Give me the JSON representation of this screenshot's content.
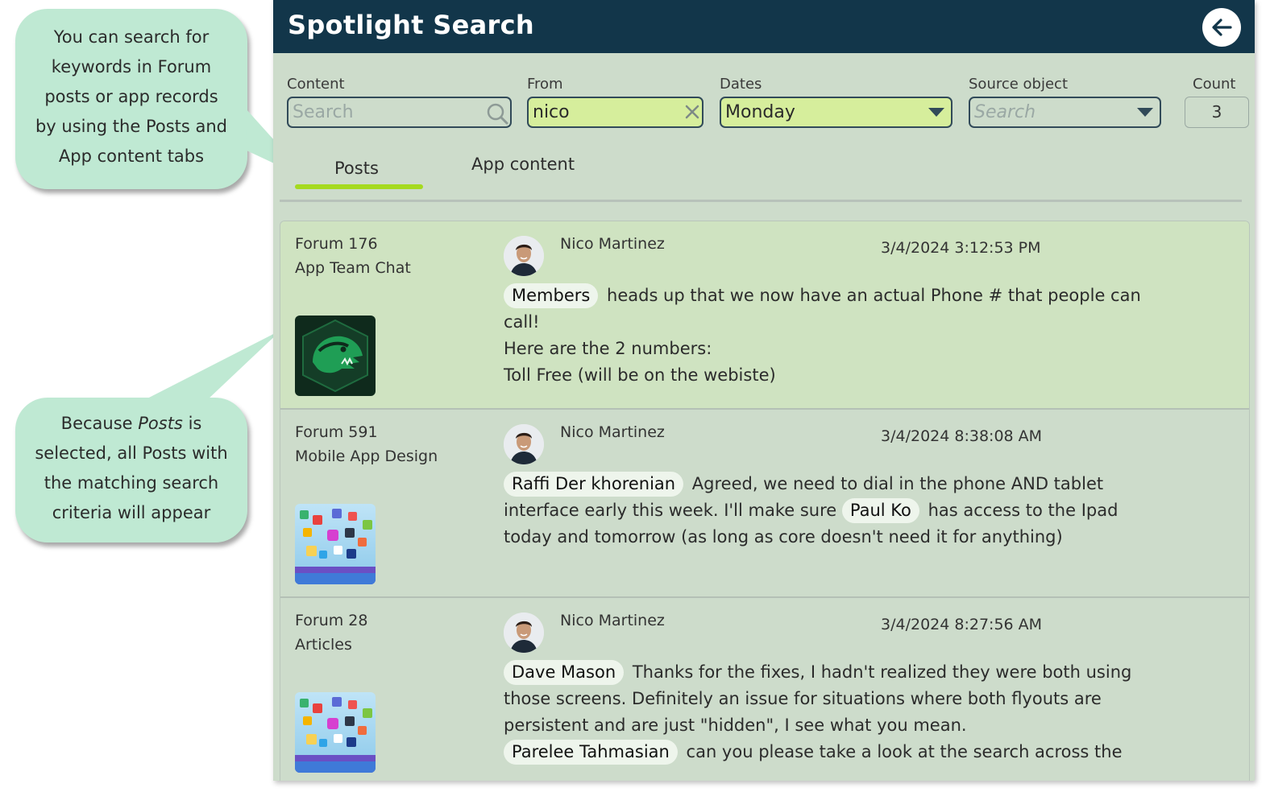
{
  "callouts": [
    {
      "lines": [
        "You can search for",
        "keywords in Forum",
        "posts or app records",
        "by using the Posts and",
        "App content tabs"
      ]
    },
    {
      "line1_pre": "Because ",
      "line1_em": "Posts",
      "line1_post": " is",
      "lines": [
        "selected, all Posts with",
        "the matching search",
        "criteria will appear"
      ]
    }
  ],
  "header": {
    "title": "Spotlight Search"
  },
  "filters": {
    "content": {
      "label": "Content",
      "placeholder": "Search"
    },
    "from": {
      "label": "From",
      "value": "nico"
    },
    "dates": {
      "label": "Dates",
      "value": "Monday"
    },
    "source": {
      "label": "Source object",
      "placeholder": "Search"
    },
    "count": {
      "label": "Count",
      "value": "3"
    }
  },
  "tabs": [
    {
      "label": "Posts",
      "selected": true
    },
    {
      "label": "App content",
      "selected": false
    }
  ],
  "colors": {
    "header": "#12364a",
    "accent": "#a5da1f",
    "field_active": "#d6ee9c",
    "callout": "#bfe9d3",
    "panel": "#cddccb"
  },
  "posts": [
    {
      "forum": "Forum 176",
      "forum_sub": "App Team Chat",
      "image": "dinosaur-logo",
      "author": "Nico Martinez",
      "timestamp": "3/4/2024 3:12:53 PM",
      "mention1": "Members",
      "line1": "heads up that we now have an actual Phone # that people can",
      "line2": "call!",
      "line3": "Here are the 2 numbers:",
      "line4": "Toll Free (will be on the webiste)"
    },
    {
      "forum": "Forum 591",
      "forum_sub": "Mobile App Design",
      "image": "app-icons",
      "author": "Nico Martinez",
      "timestamp": "3/4/2024 8:38:08 AM",
      "mention1": "Raffi Der khorenian",
      "line1": "Agreed, we need to dial in the phone AND tablet",
      "line2a": "interface early this week. I'll make sure",
      "mention2": "Paul Ko",
      "line2b": "has access to the Ipad",
      "line3": "today and tomorrow (as long as core doesn't need it for anything)"
    },
    {
      "forum": "Forum 28",
      "forum_sub": "Articles",
      "image": "app-icons",
      "author": "Nico Martinez",
      "timestamp": "3/4/2024 8:27:56 AM",
      "mention1": "Dave Mason",
      "line1": "Thanks for the fixes, I hadn't realized they were both using",
      "line2": "those screens. Definitely an issue for situations where both flyouts are",
      "line3": "persistent and are just \"hidden\", I see what you mean.",
      "mention2": "Parelee Tahmasian",
      "line4": "can you please take a look at the search across the"
    }
  ]
}
